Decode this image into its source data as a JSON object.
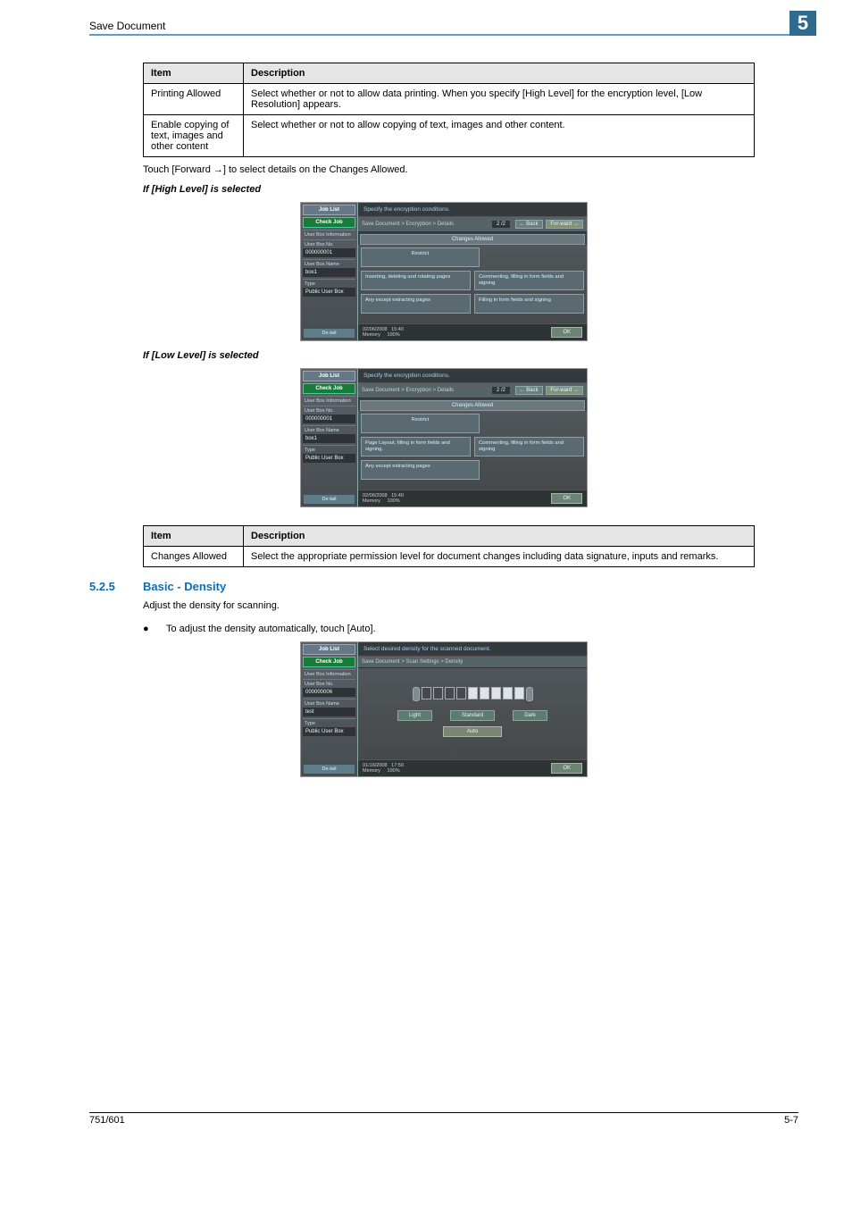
{
  "header": {
    "running_title": "Save Document",
    "chapter_number": "5"
  },
  "table1": {
    "headers": [
      "Item",
      "Description"
    ],
    "rows": [
      {
        "item": "Printing Allowed",
        "desc": "Select whether or not to allow data printing. When you specify [High Level] for the encryption level, [Low Resolution] appears."
      },
      {
        "item": "Enable copying of text, images and other content",
        "desc": "Select whether or not to allow copying of text, images and other content."
      }
    ]
  },
  "text_forward": "Touch [Forward →] to select details on the Changes Allowed.",
  "heading_high": "If [High Level] is selected",
  "heading_low": "If [Low Level] is selected",
  "shot_common": {
    "sidebar": {
      "job_list": "Job List",
      "check_job": "Check Job",
      "info_label": "User Box Information",
      "no_label": "User Box No.",
      "no_value": "000000001",
      "name_label": "User Box Name",
      "name_value": "box1",
      "type_label": "Type",
      "type_value": "Public User Box",
      "detail_btn": "De-tail"
    },
    "crumb_path": "Save Document > Encryption > Details",
    "page_indicator": "2 /2",
    "back_btn": "Back",
    "fwd_btn": "For-ward",
    "subheader": "Changes Allowed",
    "status_date": "02/06/2008",
    "status_time": "15:40",
    "status_mem": "Memory",
    "status_pct": "100%",
    "ok": "OK"
  },
  "shot_high": {
    "msg": "Specify the encryption conditions.",
    "opts": {
      "restrict": "Restrict",
      "insert": "Inserting, deleting and rotating pages",
      "comment": "Commenting, filling in form fields and signing",
      "any_extract": "Any except extracting pages",
      "fill_sign": "Filling in form fields and signing"
    }
  },
  "shot_low": {
    "msg": "Specify the encryption conditions.",
    "opts": {
      "restrict": "Restrict",
      "page_layout": "Page Layout, filling in form fields and signing.",
      "comment": "Commenting, filling in form fields and signing",
      "any_extract": "Any except extracting pages"
    }
  },
  "table2": {
    "headers": [
      "Item",
      "Description"
    ],
    "rows": [
      {
        "item": "Changes Allowed",
        "desc": "Select the appropriate permission level for document changes including data signature, inputs and remarks."
      }
    ]
  },
  "section": {
    "number": "5.2.5",
    "title": "Basic - Density",
    "intro": "Adjust the density for scanning.",
    "bullet": "To adjust the density automatically, touch [Auto]."
  },
  "shot_density": {
    "msg": "Select desired density for the scanned document.",
    "crumb_path": "Save Document > Scan Settings > Density",
    "sidebar": {
      "no_value": "000000006",
      "name_value": "test"
    },
    "light": "Light",
    "standard": "Standard",
    "dark": "Dark",
    "auto": "Auto",
    "status_date": "01/16/2008",
    "status_time": "17:50"
  },
  "footer": {
    "left": "751/601",
    "right": "5-7"
  }
}
